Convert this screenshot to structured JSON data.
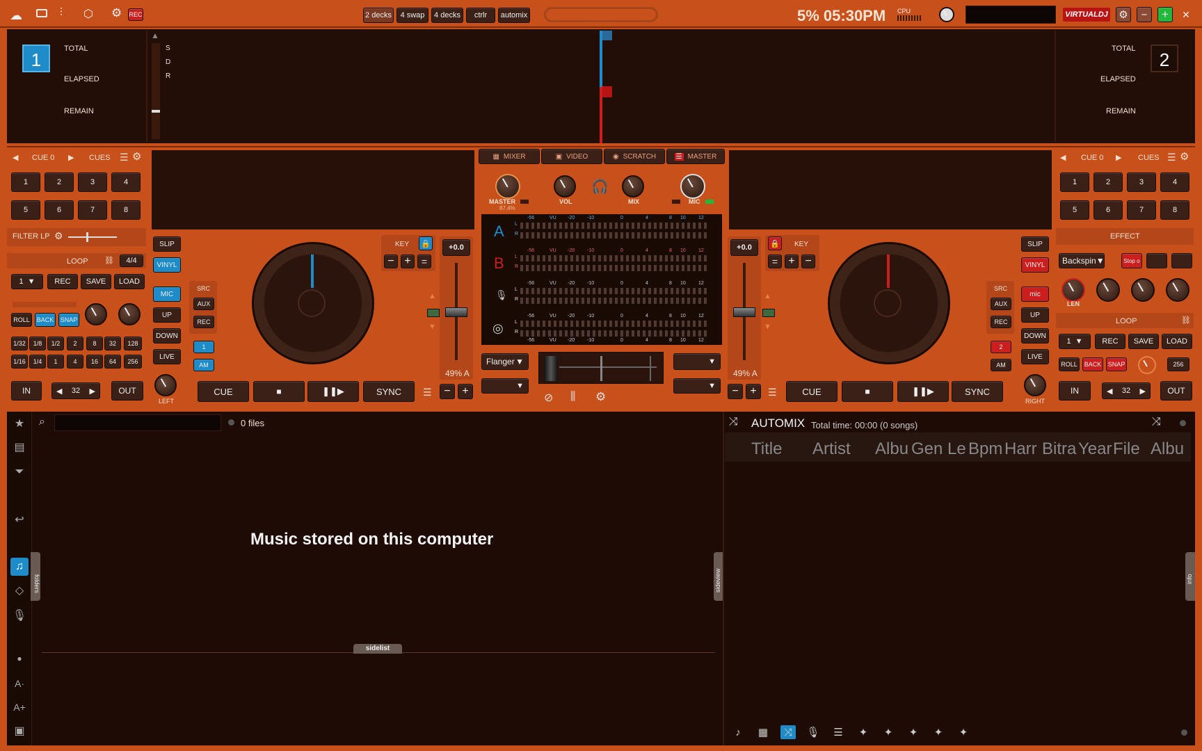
{
  "topbar": {
    "rec_label": "REC",
    "layout_buttons": [
      "2 decks",
      "4 swap",
      "4 decks",
      "ctrlr",
      "automix"
    ],
    "status": "5% 05:30PM",
    "cpu_label": "CPU",
    "logo": "VIRTUALDJ"
  },
  "wave": {
    "deck1_num": "1",
    "deck2_num": "2",
    "total": "TOTAL",
    "elapsed": "ELAPSED",
    "remain": "REMAIN",
    "sdr": [
      "S",
      "D",
      "R"
    ]
  },
  "deck_left": {
    "cue_label": "CUE 0",
    "cues": "CUES",
    "pads": [
      "1",
      "2",
      "3",
      "4",
      "5",
      "6",
      "7",
      "8"
    ],
    "filter": "FILTER LP",
    "loop": "LOOP",
    "loop_size": "4/4",
    "loop_sel": "1",
    "rec": "REC",
    "save": "SAVE",
    "load": "LOAD",
    "roll": "ROLL",
    "back": "BACK",
    "snap": "SNAP",
    "sizes_top": [
      "1/32",
      "1/8",
      "1/2",
      "2",
      "8",
      "32",
      "128"
    ],
    "sizes_bot": [
      "1/16",
      "1/4",
      "1",
      "4",
      "16",
      "64",
      "256"
    ],
    "in": "IN",
    "out": "OUT",
    "loop_len": "32",
    "slip": "SLIP",
    "vinyl": "VINYL",
    "mic": "MIC",
    "up": "UP",
    "down": "DOWN",
    "live": "LIVE",
    "src": "SRC",
    "aux": "AUX",
    "rec2": "REC",
    "ch": "1",
    "am": "AM",
    "left": "LEFT",
    "key": "KEY",
    "pitch": "+0.0",
    "pitch_pct": "49% A",
    "cue": "CUE",
    "sync": "SYNC"
  },
  "deck_right": {
    "cue_label": "CUE 0",
    "cues": "CUES",
    "pads": [
      "1",
      "2",
      "3",
      "4",
      "5",
      "6",
      "7",
      "8"
    ],
    "effect": "EFFECT",
    "effect_sel": "Backspin",
    "stop": "Stop o",
    "len": "LEN",
    "loop": "LOOP",
    "loop_sel": "1",
    "rec": "REC",
    "save": "SAVE",
    "load": "LOAD",
    "roll": "ROLL",
    "back": "BACK",
    "snap": "SNAP",
    "size": "256",
    "in": "IN",
    "out": "OUT",
    "loop_len": "32",
    "slip": "SLIP",
    "vinyl": "VINYL",
    "mic": "mic",
    "up": "UP",
    "down": "DOWN",
    "live": "LIVE",
    "src": "SRC",
    "aux": "AUX",
    "rec2": "REC",
    "ch": "2",
    "am": "AM",
    "right": "RIGHT",
    "key": "KEY",
    "pitch": "+0.0",
    "pitch_pct": "49% A",
    "cue": "CUE",
    "sync": "SYNC"
  },
  "mixer": {
    "tabs": [
      "MIXER",
      "VIDEO",
      "SCRATCH",
      "MASTER"
    ],
    "master": "MASTER",
    "master_val": "87.4%",
    "vol": "VOL",
    "mix": "MIX",
    "mic": "MIC",
    "chan_a": "A",
    "chan_b": "B",
    "vu": "VU",
    "scale": [
      "-56",
      "VU",
      "-20",
      "-10",
      "0",
      "4",
      "8",
      "10",
      "12"
    ],
    "lr": [
      "L",
      "R"
    ],
    "fx_sel": "Flanger"
  },
  "browser": {
    "files": "0 files",
    "empty_text": "Music stored on this computer",
    "folders_tab": "folders",
    "sideview_tab": "sideview",
    "sidelist_tab": "sidelist",
    "info_tab": "info",
    "automix_title": "AUTOMIX",
    "automix_info": "Total time: 00:00 (0 songs)",
    "columns": [
      "Title",
      "Artist",
      "Albu",
      "Gen",
      "Le",
      "Bpm",
      "Harr",
      "Bitra",
      "Year",
      "File",
      "Albu"
    ]
  },
  "colors": {
    "accent": "#c8501a",
    "blue": "#1e8cc8",
    "red": "#cc1e1e"
  }
}
